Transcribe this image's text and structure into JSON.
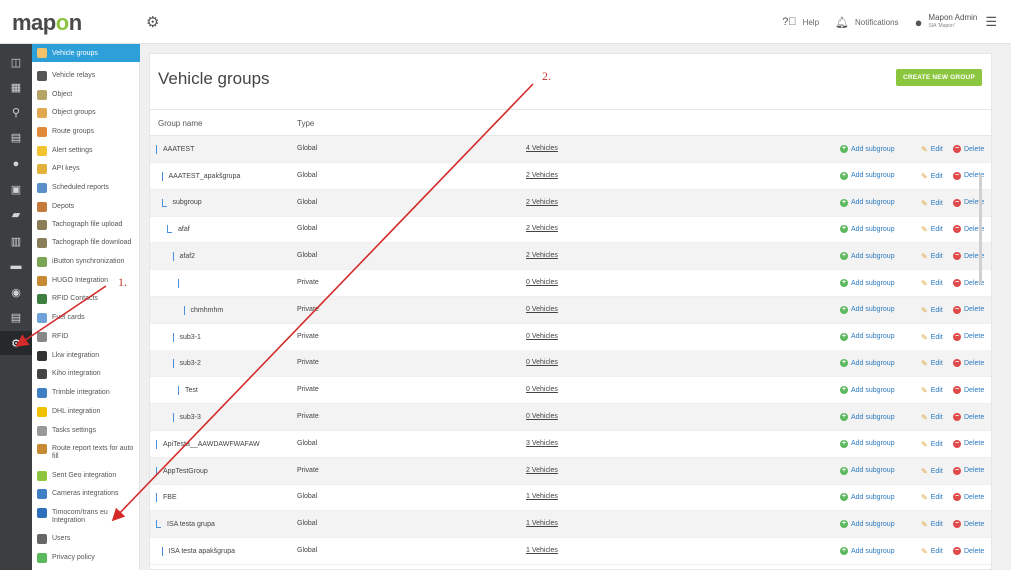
{
  "app": {
    "logo": "mapon",
    "help_label": "Help",
    "notifications_label": "Notifications",
    "user_name": "Mapon Admin",
    "user_org": "SIA 'Mapon'"
  },
  "rail_icons": [
    "map-icon",
    "dashboard-icon",
    "route-icon",
    "document-icon",
    "alert-icon",
    "fuel-icon",
    "chat-icon",
    "clipboard-icon",
    "vehicle-icon",
    "user-icon",
    "report-icon",
    "settings-icon"
  ],
  "submenu": [
    {
      "label": "Vehicle groups",
      "color": "#f3c26b",
      "active": true
    },
    {
      "label": "Vehicle relays",
      "color": "#555555"
    },
    {
      "label": "Object",
      "color": "#b6a566"
    },
    {
      "label": "Object groups",
      "color": "#e2a84f"
    },
    {
      "label": "Route groups",
      "color": "#e08a3a"
    },
    {
      "label": "Alert settings",
      "color": "#f2c230"
    },
    {
      "label": "API keys",
      "color": "#e3b23c"
    },
    {
      "label": "Scheduled reports",
      "color": "#5a8fc9"
    },
    {
      "label": "Depots",
      "color": "#c47a3a"
    },
    {
      "label": "Tachograph file upload",
      "color": "#8a7e5a"
    },
    {
      "label": "Tachograph file download",
      "color": "#8a7e5a"
    },
    {
      "label": "iButton synchronization",
      "color": "#7aa552"
    },
    {
      "label": "HUGO Integration",
      "color": "#c98a34"
    },
    {
      "label": "RFID Contacts",
      "color": "#3f7f3f"
    },
    {
      "label": "Fuel cards",
      "color": "#6fa2d8"
    },
    {
      "label": "RFID",
      "color": "#888888"
    },
    {
      "label": "Lkw integration",
      "color": "#333333"
    },
    {
      "label": "Kiho integration",
      "color": "#444444"
    },
    {
      "label": "Trimble integration",
      "color": "#3f7fc4"
    },
    {
      "label": "DHL integration",
      "color": "#f2c200"
    },
    {
      "label": "Tasks settings",
      "color": "#999999"
    },
    {
      "label": "Route report texts for auto fill",
      "color": "#c98a34"
    },
    {
      "label": "Sent Geo integration",
      "color": "#8cc63f"
    },
    {
      "label": "Cameras integrations",
      "color": "#3f7fc4"
    },
    {
      "label": "Timocom/trans eu Integration",
      "color": "#2d6fb8"
    },
    {
      "label": "Users",
      "color": "#666666"
    },
    {
      "label": "Privacy policy",
      "color": "#5cb85c"
    }
  ],
  "page": {
    "title": "Vehicle groups",
    "create_button": "CREATE NEW GROUP",
    "col_name": "Group name",
    "col_type": "Type",
    "add_label": "Add subgroup",
    "edit_label": "Edit",
    "delete_label": "Delete"
  },
  "rows": [
    {
      "name": "AAATEST",
      "type": "Global",
      "vehicles": "4 Vehicles",
      "indent": 0,
      "style": "bar"
    },
    {
      "name": "AAATEST_apakšgrupa",
      "type": "Global",
      "vehicles": "2 Vehicles",
      "indent": 1,
      "style": "bar"
    },
    {
      "name": "subgroup",
      "type": "Global",
      "vehicles": "2 Vehicles",
      "indent": 1,
      "style": "l"
    },
    {
      "name": "afaf",
      "type": "Global",
      "vehicles": "2 Vehicles",
      "indent": 2,
      "style": "l"
    },
    {
      "name": "afaf2",
      "type": "Global",
      "vehicles": "2 Vehicles",
      "indent": 3,
      "style": "bar"
    },
    {
      "name": "",
      "type": "Private",
      "vehicles": "0 Vehicles",
      "indent": 4,
      "style": "bar"
    },
    {
      "name": "chmhmhm",
      "type": "Private",
      "vehicles": "0 Vehicles",
      "indent": 5,
      "style": "bar"
    },
    {
      "name": "sub3-1",
      "type": "Private",
      "vehicles": "0 Vehicles",
      "indent": 3,
      "style": "bar"
    },
    {
      "name": "sub3-2",
      "type": "Private",
      "vehicles": "0 Vehicles",
      "indent": 3,
      "style": "bar"
    },
    {
      "name": "Test",
      "type": "Private",
      "vehicles": "0 Vehicles",
      "indent": 4,
      "style": "bar"
    },
    {
      "name": "sub3-3",
      "type": "Private",
      "vehicles": "0 Vehicles",
      "indent": 3,
      "style": "bar"
    },
    {
      "name": "ApiTesta__AAWDAWFWAFAW",
      "type": "Global",
      "vehicles": "3 Vehicles",
      "indent": 0,
      "style": "bar"
    },
    {
      "name": "AppTestGroup",
      "type": "Private",
      "vehicles": "2 Vehicles",
      "indent": 0,
      "style": "bar"
    },
    {
      "name": "FBE",
      "type": "Global",
      "vehicles": "1 Vehicles",
      "indent": 0,
      "style": "bar"
    },
    {
      "name": "ISA testa grupa",
      "type": "Global",
      "vehicles": "1 Vehicles",
      "indent": 0,
      "style": "l"
    },
    {
      "name": "ISA testa apakšgrupa",
      "type": "Global",
      "vehicles": "1 Vehicles",
      "indent": 1,
      "style": "bar"
    }
  ],
  "annotations": {
    "step1": "1.",
    "step2": "2.",
    "color": "#d42a2a"
  },
  "colors": {
    "accent": "#8cc63f",
    "active_menu": "#2d9fd9",
    "rail": "#3c3f41"
  }
}
